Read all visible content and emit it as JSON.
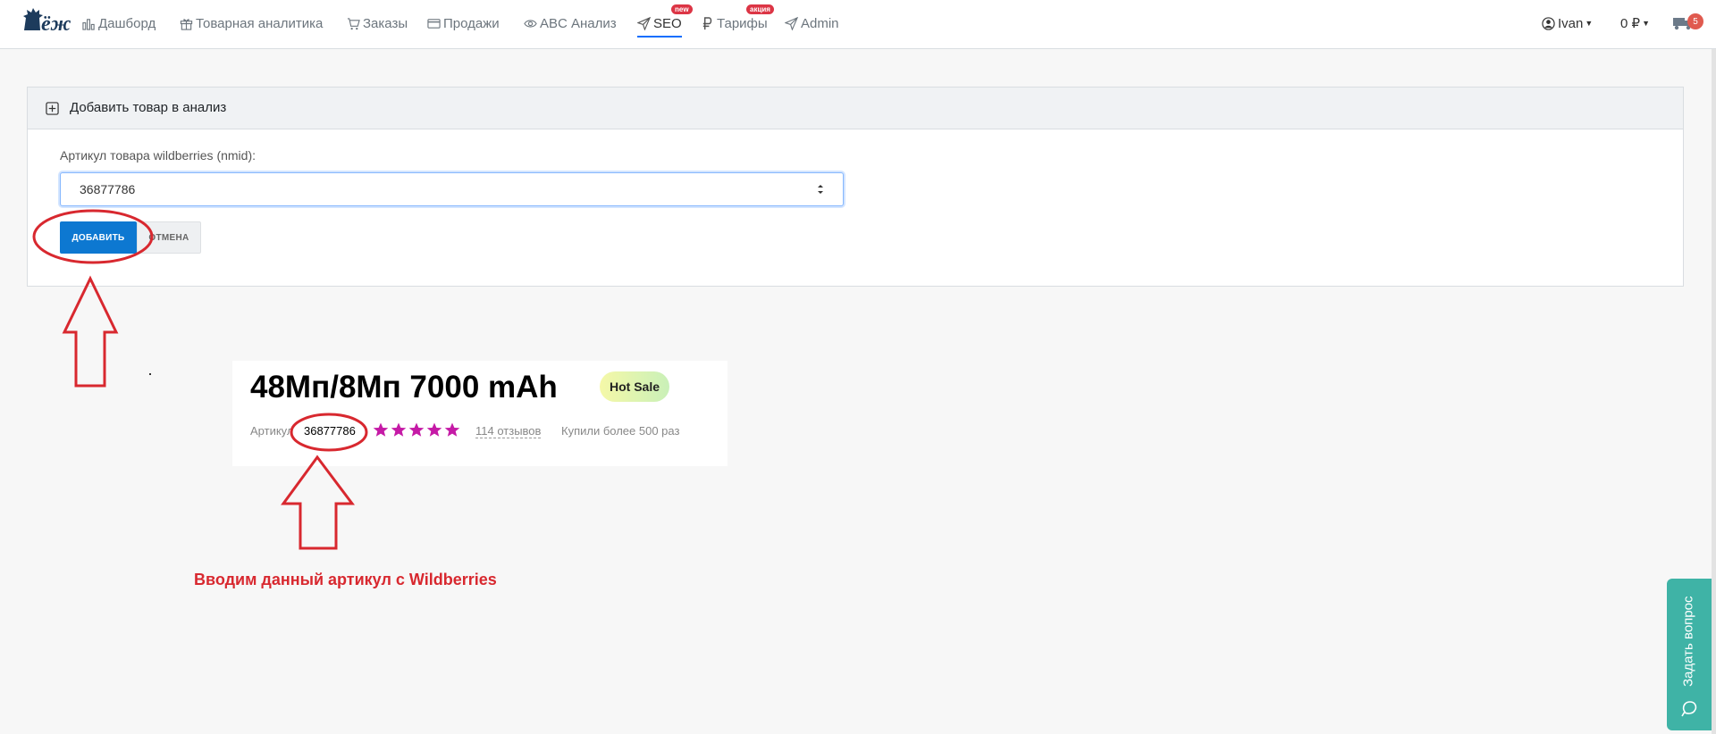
{
  "navbar": {
    "logo_text": "ёж",
    "items": [
      {
        "label": "Дашборд",
        "icon": "bar-chart-icon"
      },
      {
        "label": "Товарная аналитика",
        "icon": "gift-icon"
      },
      {
        "label": "Заказы",
        "icon": "cart-icon"
      },
      {
        "label": "Продажи",
        "icon": "card-icon"
      },
      {
        "label": "ABC Анализ",
        "icon": "eye-icon"
      },
      {
        "label": "SEO",
        "icon": "send-icon",
        "badge": "new",
        "active": true
      },
      {
        "label": "Тарифы",
        "icon": "ruble-icon",
        "badge": "акция"
      },
      {
        "label": "Admin",
        "icon": "send-icon"
      }
    ],
    "user": "Ivan",
    "balance": "0 ₽",
    "cart_count": "5"
  },
  "add_card": {
    "header": "Добавить товар в анализ",
    "field_label": "Артикул товара wildberries (nmid):",
    "nmid_value": "36877786",
    "add_button": "ДОБАВИТЬ",
    "cancel_button": "ОТМЕНА"
  },
  "product": {
    "title": "48Мп/8Мп 7000 mAh",
    "badge": "Hot Sale",
    "sku_label": "Артикул",
    "sku_value": "36877786",
    "rating_stars": 5,
    "reviews": "114 отзывов",
    "bought": "Купили более 500 раз"
  },
  "annotation": "Вводим данный артикул с Wildberries",
  "ask_question": "Задать вопрос",
  "colors": {
    "primary": "#0d78d1",
    "annotation_red": "#d8282f",
    "star": "#c51aa6",
    "teal": "#3fb3a6"
  }
}
